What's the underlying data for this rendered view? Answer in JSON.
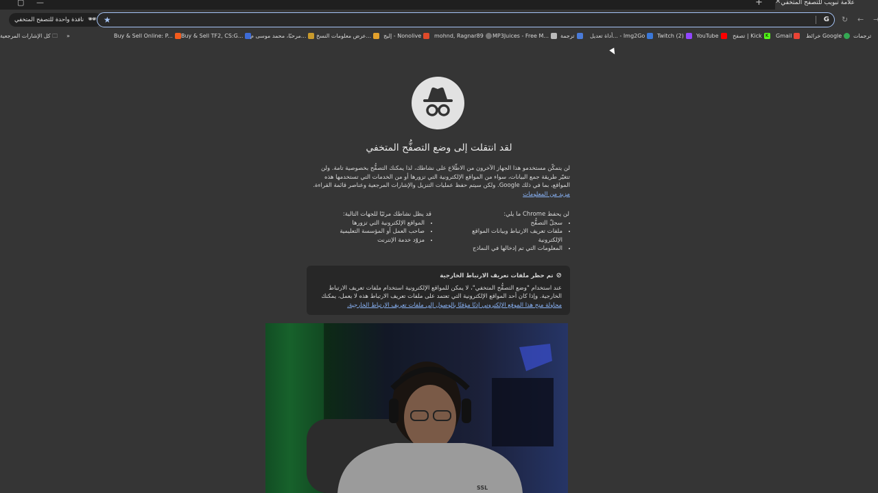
{
  "window": {
    "tab_title": "علامة تبويب للتصفح المتخفي",
    "new_tab_glyph": "+",
    "close_glyph": "✕"
  },
  "toolbar": {
    "incognito_label": "نافذة واحدة للتصفح المتخفي",
    "omnibox_value": "",
    "omnibox_engine_glyph": "G",
    "back_glyph": "←",
    "forward_glyph": "→",
    "reload_glyph": "↻",
    "star_glyph": "★"
  },
  "bookmarks": {
    "all_bookmarks": "كل الإشارات المرجعية",
    "overflow": "»",
    "items": [
      "ترجمات",
      "خرائط Google",
      "Gmail",
      "تصفح | Kick",
      "YouTube",
      "Twitch (2)",
      "أداة تعديل... - Img2Go",
      "ترجمة",
      "MP3Juices - Free M...",
      "mohnd, Ragnar89",
      "إليج - Nonolive",
      "عرض معلومات النسخ...",
      "مرحبًا، محمد موسى م...",
      "Buy & Sell TF2, CS:G...",
      "Buy & Sell Online: P..."
    ]
  },
  "page": {
    "heading": "لقد انتقلت إلى وضع التصفُّح المتخفي",
    "intro_text": "لن يتمكّن مستخدمو هذا الجهاز الآخرون من الاطّلاع على نشاطك، لذا يمكنك التصفُّح بخصوصية تامة. ولن تتغيّر طريقة جمع البيانات، سواء من المواقع الإلكترونية التي تزورها أو من الخدمات التي تستخدمها هذه المواقع، بما في ذلك Google. ولكن سيتم حفظ عمليات التنزيل والإشارات المرجعية وعناصر قائمة القراءة.",
    "learn_more": "مزيد من المعلومات",
    "not_saved_title": "لن يحفظ Chrome ما يلي:",
    "not_saved_items": [
      "سجلّ التصفُّح",
      "ملفات تعريف الارتباط وبيانات المواقع الإلكترونية",
      "المعلومات التي تم إدخالها في النماذج"
    ],
    "visible_title": "قد يظل نشاطك مرئيًا للجهات التالية:",
    "visible_items": [
      "المواقع الإلكترونية التي تزورها",
      "صاحب العمل أو المؤسسة التعليمية",
      "مزوّد خدمة الإنترنت"
    ],
    "cookies_title": "تم حظر ملفات تعريف الارتباط الخارجية",
    "cookies_text": "عند استخدام \"وضع التصفُّح المتخفي\"، لا يمكن للمواقع الإلكترونية استخدام ملفات تعريف الارتباط الخارجية. وإذا كان أحد المواقع الإلكترونية التي تعتمد على ملفات تعريف الارتباط هذه لا يعمل،",
    "cookies_prefix": "يمكنك",
    "cookies_link": "محاولة منح هذا الموقع الإلكتروني إذنًا مؤقتًا بالوصول إلى ملفات تعريف الارتباط الخارجية."
  },
  "webcam": {
    "shirt_text": "SSL"
  },
  "colors": {
    "page_bg": "#353535",
    "link": "#8ab4f8",
    "omnibox_border": "#a8c7fa"
  }
}
